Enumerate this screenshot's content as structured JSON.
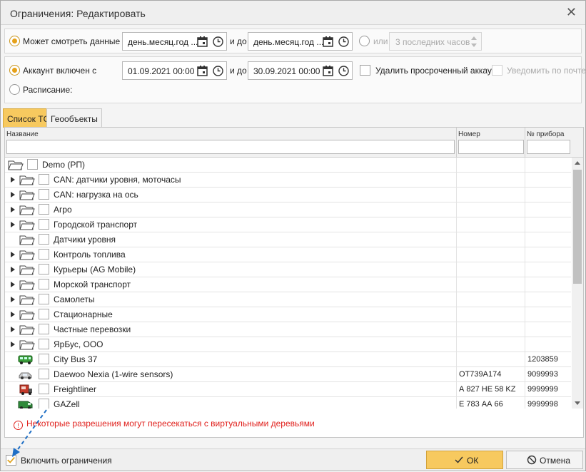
{
  "dialog": {
    "title": "Ограничения: Редактировать"
  },
  "view_data": {
    "label": "Может смотреть данные с",
    "from_placeholder": "день.месяц.год ...",
    "to_label": "и до",
    "to_placeholder": "день.месяц.год ...",
    "or_label": "или",
    "last_hours_value": "3 последних часов"
  },
  "account": {
    "enabled_label": "Аккаунт включен с",
    "from_value": "01.09.2021 00:00",
    "to_label": "и до",
    "to_value": "30.09.2021 00:00",
    "delete_expired_label": "Удалить просроченный аккаунт",
    "notify_email_label": "Уведомить по почте",
    "schedule_label": "Расписание:"
  },
  "tabs": [
    {
      "label": "Список ТС",
      "active": true
    },
    {
      "label": "Геообъекты",
      "active": false
    }
  ],
  "grid": {
    "columns": [
      "Название",
      "Номер",
      "№ прибора"
    ],
    "rows": [
      {
        "type": "root-folder",
        "name": "Demo (РП)",
        "number": "",
        "device": "",
        "expandable": false
      },
      {
        "type": "folder",
        "name": "CAN: датчики уровня, моточасы",
        "number": "",
        "device": "",
        "expandable": true
      },
      {
        "type": "folder",
        "name": "CAN: нагрузка на ось",
        "number": "",
        "device": "",
        "expandable": true
      },
      {
        "type": "folder",
        "name": "Агро",
        "number": "",
        "device": "",
        "expandable": true
      },
      {
        "type": "folder",
        "name": "Городской транспорт",
        "number": "",
        "device": "",
        "expandable": true
      },
      {
        "type": "folder",
        "name": "Датчики уровня",
        "number": "",
        "device": "",
        "expandable": false
      },
      {
        "type": "folder",
        "name": "Контроль топлива",
        "number": "",
        "device": "",
        "expandable": true
      },
      {
        "type": "folder",
        "name": "Курьеры (AG Mobile)",
        "number": "",
        "device": "",
        "expandable": true
      },
      {
        "type": "folder",
        "name": "Морской транспорт",
        "number": "",
        "device": "",
        "expandable": true
      },
      {
        "type": "folder",
        "name": "Самолеты",
        "number": "",
        "device": "",
        "expandable": true
      },
      {
        "type": "folder",
        "name": "Стационарные",
        "number": "",
        "device": "",
        "expandable": true
      },
      {
        "type": "folder",
        "name": "Частные перевозки",
        "number": "",
        "device": "",
        "expandable": true
      },
      {
        "type": "folder",
        "name": "ЯрБус, ООО",
        "number": "",
        "device": "",
        "expandable": true
      },
      {
        "type": "vehicle",
        "icon": "bus-icon",
        "name": "City Bus 37",
        "number": "",
        "device": "1203859"
      },
      {
        "type": "vehicle",
        "icon": "car-icon",
        "name": "Daewoo Nexia (1-wire sensors)",
        "number": "ОТ739А174",
        "device": "9099993"
      },
      {
        "type": "vehicle",
        "icon": "truck-icon",
        "name": "Freightliner",
        "number": "А 827 НЕ 58 KZ",
        "device": "9999999"
      },
      {
        "type": "vehicle",
        "icon": "van-icon",
        "name": "GAZell",
        "number": "Е 783 АА 66",
        "device": "9999998"
      }
    ]
  },
  "warning": {
    "text": "Некоторые разрешения могут пересекаться с виртуальными деревьями"
  },
  "footer": {
    "enable_label": "Включить ограничения",
    "ok_label": "ОК",
    "cancel_label": "Отмена"
  },
  "colors": {
    "accent": "#f7c95f",
    "warning": "#e0201c",
    "annotation_arrow": "#1f6fc5"
  }
}
